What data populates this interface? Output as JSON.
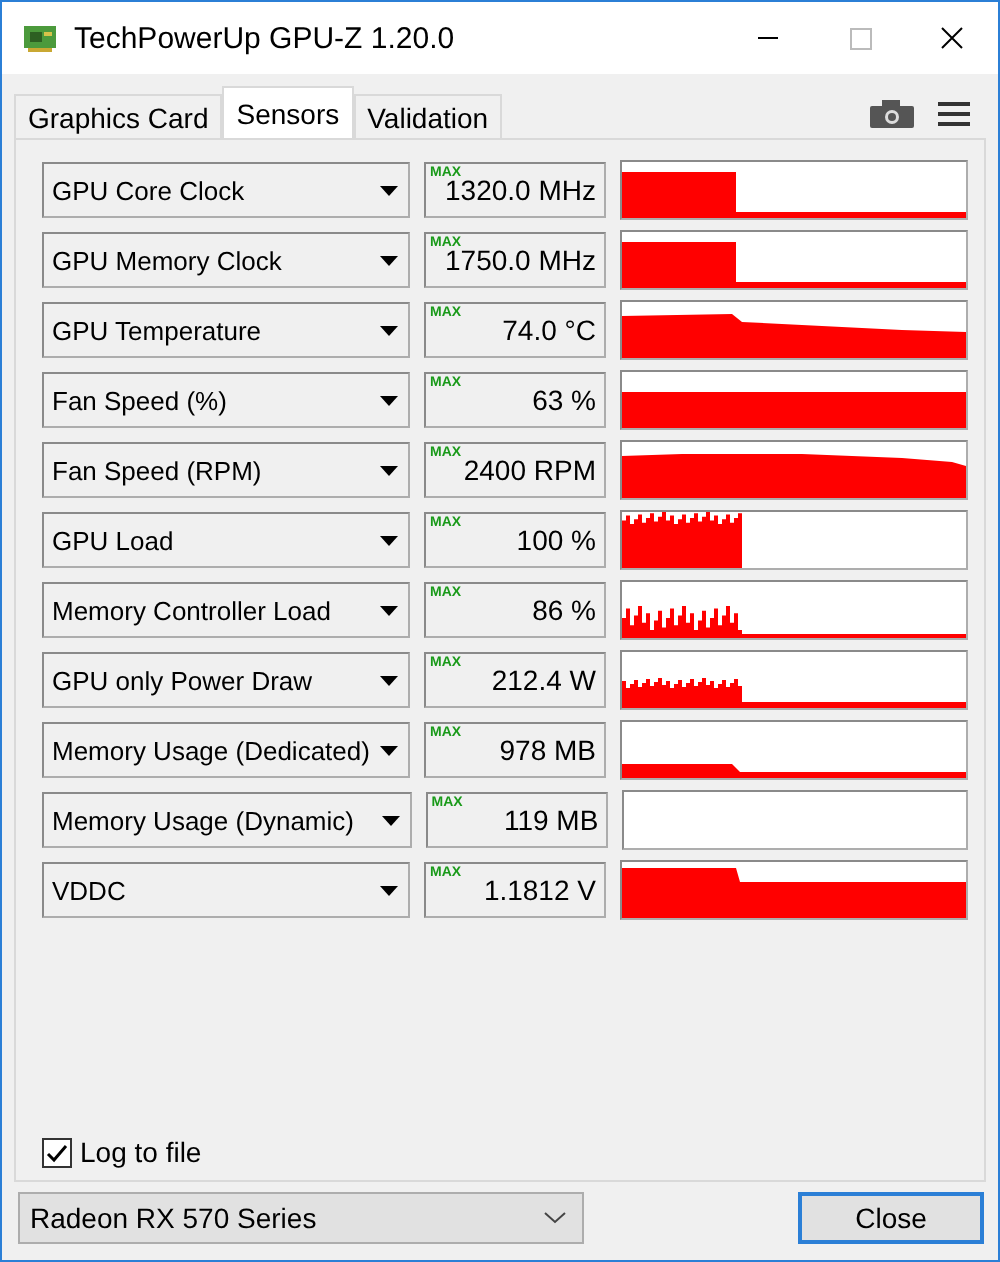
{
  "window": {
    "title": "TechPowerUp GPU-Z 1.20.0"
  },
  "tabs": [
    {
      "label": "Graphics Card",
      "selected": false
    },
    {
      "label": "Sensors",
      "selected": true
    },
    {
      "label": "Validation",
      "selected": false
    }
  ],
  "sensors": [
    {
      "name": "GPU Core Clock",
      "max_label": "MAX",
      "value": "1320.0 MHz"
    },
    {
      "name": "GPU Memory Clock",
      "max_label": "MAX",
      "value": "1750.0 MHz"
    },
    {
      "name": "GPU Temperature",
      "max_label": "MAX",
      "value": "74.0 °C"
    },
    {
      "name": "Fan Speed (%)",
      "max_label": "MAX",
      "value": "63 %"
    },
    {
      "name": "Fan Speed (RPM)",
      "max_label": "MAX",
      "value": "2400 RPM"
    },
    {
      "name": "GPU Load",
      "max_label": "MAX",
      "value": "100 %"
    },
    {
      "name": "Memory Controller Load",
      "max_label": "MAX",
      "value": "86 %"
    },
    {
      "name": "GPU only Power Draw",
      "max_label": "MAX",
      "value": "212.4 W"
    },
    {
      "name": "Memory Usage (Dedicated)",
      "max_label": "MAX",
      "value": "978 MB"
    },
    {
      "name": "Memory Usage (Dynamic)",
      "max_label": "MAX",
      "value": "119 MB"
    },
    {
      "name": "VDDC",
      "max_label": "MAX",
      "value": "1.1812 V"
    }
  ],
  "log_to_file": {
    "label": "Log to file",
    "checked": true
  },
  "gpu_select": {
    "value": "Radeon RX 570 Series"
  },
  "close_button": "Close"
}
